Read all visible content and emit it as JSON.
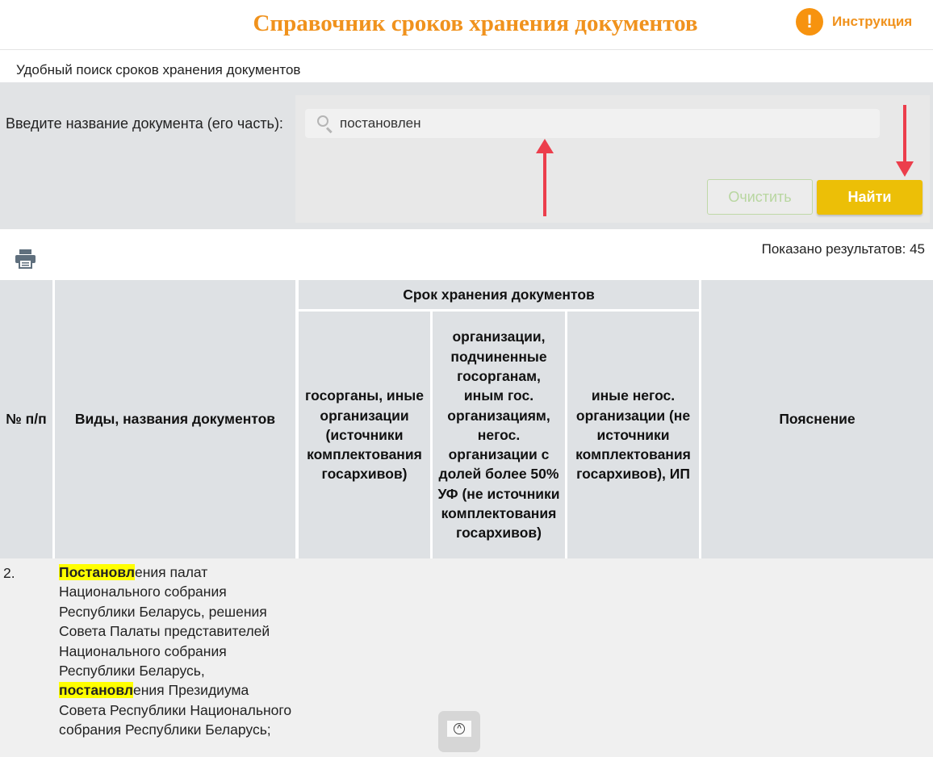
{
  "header": {
    "title": "Справочник сроков хранения документов",
    "instruction_icon": "!",
    "instruction_label": "Инструкция"
  },
  "subtitle": "Удобный поиск сроков хранения документов",
  "search": {
    "label": "Введите название документа (его часть):",
    "value": "постановлен",
    "clear_label": "Очистить",
    "find_label": "Найти"
  },
  "results_text": "Показано результатов: 45",
  "table": {
    "col_num": "№ п/п",
    "col_name": "Виды, названия документов",
    "col_group": "Срок хранения документов",
    "col_gov": "госорганы, иные организации (источники комплектования госархивов)",
    "col_sub": "организации, подчиненные госорганам, иным гос. организациям, негос. организации с долей более 50% УФ (не источники комплектования госархивов)",
    "col_other": "иные негос. организации (не источники комплектования госархивов), ИП",
    "col_note": "Пояснение"
  },
  "row": {
    "num": "2.",
    "hl1": "Постановл",
    "text1": "ения палат Национального собрания Республики Беларусь, решения Совета Палаты представителей Национального собрания Республики Беларусь, ",
    "hl2": "постановл",
    "text2": "ения Президиума Совета Республики Национального собрания Республики Беларусь;"
  },
  "icons": {
    "instruction": "exclamation-circle-icon",
    "search": "magnifier-icon",
    "print": "printer-icon",
    "scroll_top": "chevron-up-circle-icon"
  },
  "colors": {
    "accent": "#f0921d",
    "find_button": "#ecbf07",
    "highlight": "#ffff00",
    "annotation_arrow": "#ec3e4c"
  }
}
